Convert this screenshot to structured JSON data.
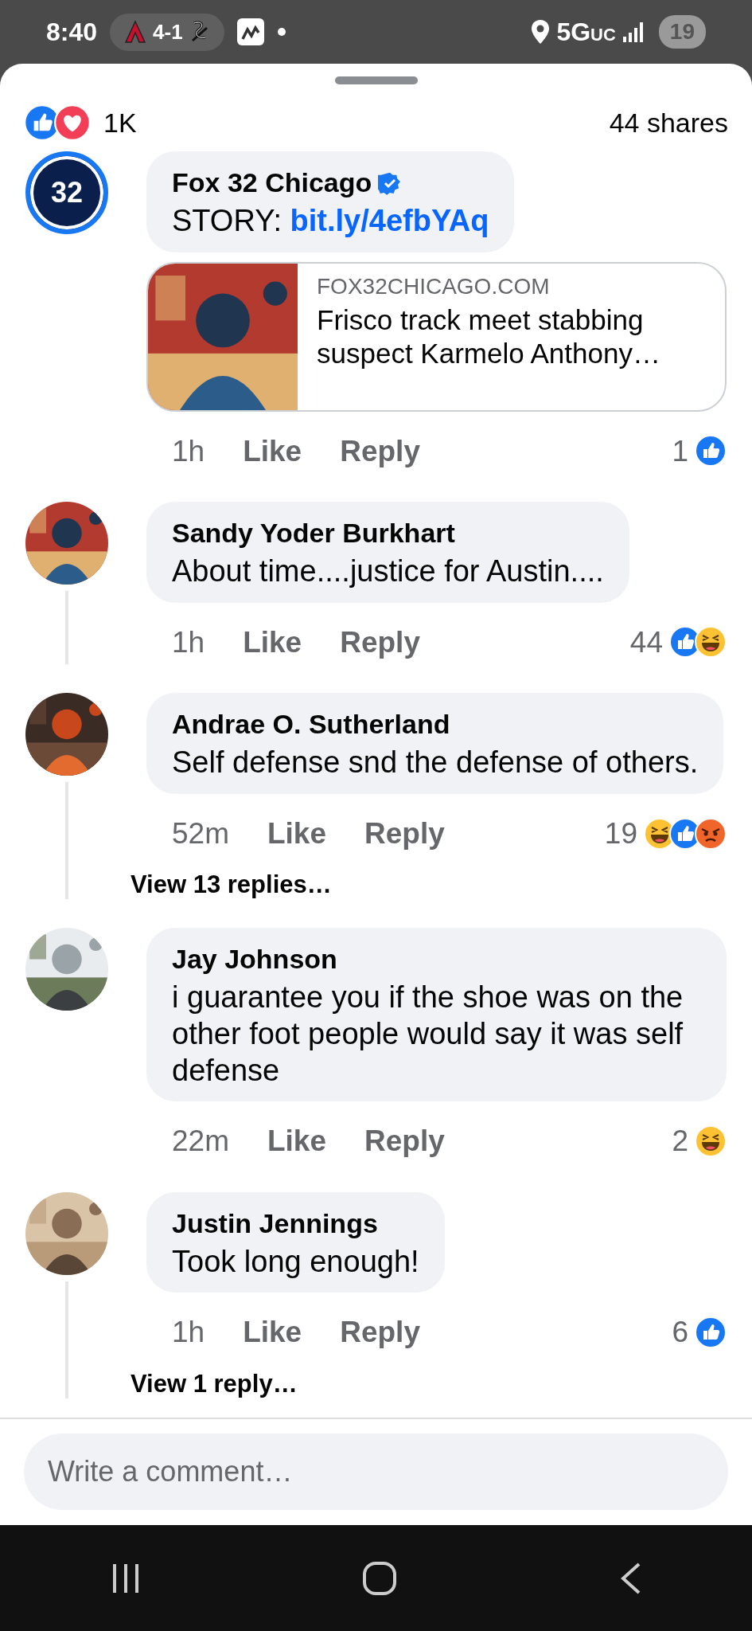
{
  "status_bar": {
    "time": "8:40",
    "score": "4-1",
    "network": "5G",
    "network_suffix": "UC",
    "battery": "19"
  },
  "summary": {
    "reactions": [
      {
        "kind": "like"
      },
      {
        "kind": "love"
      }
    ],
    "reaction_count": "1K",
    "shares": "44 shares"
  },
  "comments": [
    {
      "author": "Fox 32 Chicago",
      "avatar": {
        "kind": "logo",
        "text": "32"
      },
      "verified": true,
      "text_prefix": "STORY: ",
      "link": "bit.ly/4efbYAq",
      "thread_line": false,
      "link_preview": {
        "domain": "FOX32CHICAGO.COM",
        "title": "Frisco track meet stabbing suspect Karmelo Anthony…"
      },
      "time": "1h",
      "like": "Like",
      "reply": "Reply",
      "reaction_count": "1",
      "reactions": [
        {
          "kind": "like"
        }
      ]
    },
    {
      "author": "Sandy Yoder Burkhart",
      "avatar": {
        "kind": "picture"
      },
      "verified": false,
      "text": "About time....justice for Austin....",
      "thread_line": true,
      "time": "1h",
      "like": "Like",
      "reply": "Reply",
      "reaction_count": "44",
      "reactions": [
        {
          "kind": "like"
        },
        {
          "kind": "haha"
        }
      ]
    },
    {
      "author": "Andrae O. Sutherland",
      "avatar": {
        "kind": "picture"
      },
      "verified": false,
      "text": "Self defense snd the defense of others.",
      "thread_line": true,
      "time": "52m",
      "like": "Like",
      "reply": "Reply",
      "reaction_count": "19",
      "reactions": [
        {
          "kind": "haha"
        },
        {
          "kind": "like"
        },
        {
          "kind": "angry"
        }
      ],
      "view_replies": "View 13 replies…"
    },
    {
      "author": "Jay Johnson",
      "avatar": {
        "kind": "picture"
      },
      "verified": false,
      "text": "i guarantee you if the shoe was on the other foot people would say it was self defense",
      "thread_line": false,
      "time": "22m",
      "like": "Like",
      "reply": "Reply",
      "reaction_count": "2",
      "reactions": [
        {
          "kind": "haha"
        }
      ]
    },
    {
      "author": "Justin Jennings",
      "avatar": {
        "kind": "picture"
      },
      "verified": false,
      "text": "Took long enough!",
      "thread_line": true,
      "time": "1h",
      "like": "Like",
      "reply": "Reply",
      "reaction_count": "6",
      "reactions": [
        {
          "kind": "like"
        }
      ],
      "view_replies": "View 1 reply…"
    }
  ],
  "composer": {
    "placeholder": "Write a comment…"
  }
}
